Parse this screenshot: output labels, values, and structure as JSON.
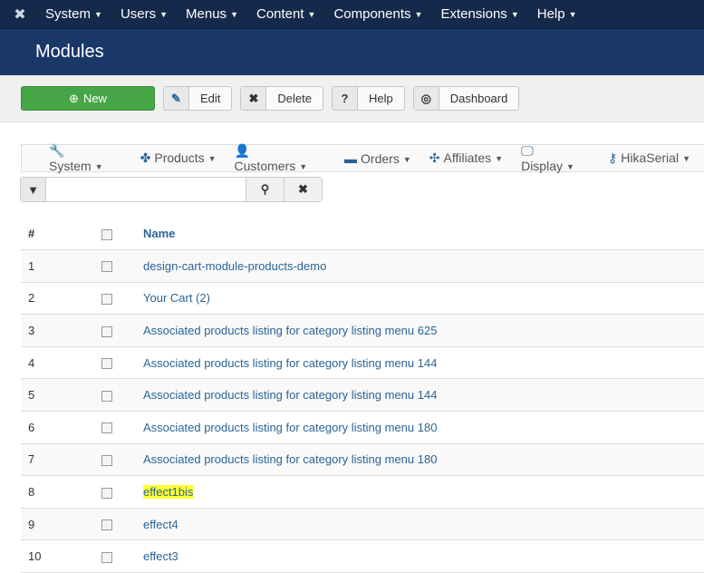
{
  "topnav": {
    "items": [
      "System",
      "Users",
      "Menus",
      "Content",
      "Components",
      "Extensions",
      "Help"
    ]
  },
  "page_title": "Modules",
  "toolbar": {
    "new": "New",
    "edit": "Edit",
    "delete": "Delete",
    "help": "Help",
    "dashboard": "Dashboard"
  },
  "submenu": [
    {
      "icon": "wrench-icon",
      "glyph": "🔧",
      "label": "System"
    },
    {
      "icon": "cubes-icon",
      "glyph": "✤",
      "label": "Products"
    },
    {
      "icon": "user-icon",
      "glyph": "👤",
      "label": "Customers"
    },
    {
      "icon": "credit-card-icon",
      "glyph": "▬",
      "label": "Orders"
    },
    {
      "icon": "users-icon",
      "glyph": "✣",
      "label": "Affiliates"
    },
    {
      "icon": "monitor-icon",
      "glyph": "🖵",
      "label": "Display"
    },
    {
      "icon": "key-icon",
      "glyph": "⚷",
      "label": "HikaSerial"
    }
  ],
  "search": {
    "value": "",
    "placeholder": ""
  },
  "table": {
    "headers": {
      "num": "#",
      "name": "Name"
    },
    "rows": [
      {
        "num": "1",
        "name": "design-cart-module-products-demo"
      },
      {
        "num": "2",
        "name": "Your Cart (2)"
      },
      {
        "num": "3",
        "name": "Associated products listing for category listing menu 625"
      },
      {
        "num": "4",
        "name": "Associated products listing for category listing menu 144"
      },
      {
        "num": "5",
        "name": "Associated products listing for category listing menu 144"
      },
      {
        "num": "6",
        "name": "Associated products listing for category listing menu 180"
      },
      {
        "num": "7",
        "name": "Associated products listing for category listing menu 180"
      },
      {
        "num": "8",
        "name": "effect1bis",
        "highlight": true
      },
      {
        "num": "9",
        "name": "effect4"
      },
      {
        "num": "10",
        "name": "effect3"
      }
    ]
  },
  "colors": {
    "topnav": "#152a4a",
    "titlebar": "#1a3867",
    "new_button": "#46a546",
    "link": "#2a6496",
    "highlight": "#ffff33"
  }
}
